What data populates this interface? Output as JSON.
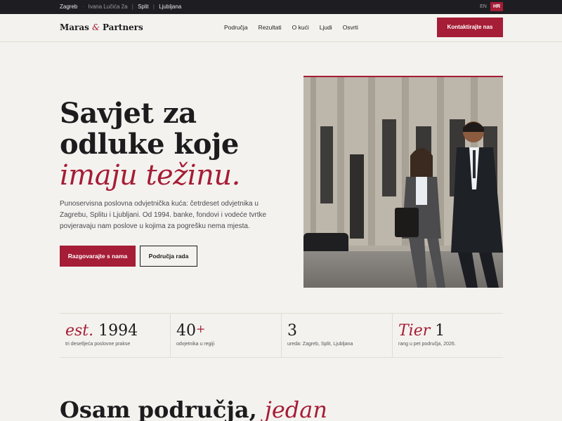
{
  "topbar": {
    "city_main": "Zagreb",
    "address": "Ivana Lučića 2a",
    "city_2": "Split",
    "city_3": "Ljubljana",
    "languages": [
      "EN",
      "HR"
    ],
    "active_language": "HR"
  },
  "header": {
    "logo_part1": "Maras",
    "logo_amp": "&",
    "logo_part2": "Partners",
    "nav": [
      "Područja",
      "Rezultati",
      "O kući",
      "Ljudi",
      "Osvrti"
    ],
    "cta": "Kontaktirajte nas"
  },
  "hero": {
    "title_line1": "Savjet za",
    "title_line2": "odluke koje",
    "title_line3": "imaju težinu.",
    "description": "Punoservisna poslovna odvjetnička kuća: četrdeset odvjetnika u Zagrebu, Splitu i Ljubljani. Od 1994. banke, fondovi i vodeće tvrtke povjeravaju nam poslove u kojima za pogrešku nema mjesta.",
    "primary_button": "Razgovarajte s nama",
    "secondary_button": "Područja rada"
  },
  "stats": [
    {
      "prefix": "est.",
      "value": "1994",
      "suffix": "",
      "label": "tri desetljeća poslovne prakse"
    },
    {
      "prefix": "",
      "value": "40",
      "suffix": "+",
      "label": "odvjetnika u regiji"
    },
    {
      "prefix": "",
      "value": "3",
      "suffix": "",
      "label": "ureda: Zagreb, Split, Ljubljana"
    },
    {
      "prefix": "Tier",
      "value": "1",
      "suffix": "",
      "label": "rang u pet područja, 2026."
    }
  ],
  "section": {
    "title_main": "Osam područja,",
    "title_accent": "jedan"
  },
  "colors": {
    "accent": "#a51d36",
    "dark": "#1e1e22",
    "background": "#f4f2ee"
  }
}
